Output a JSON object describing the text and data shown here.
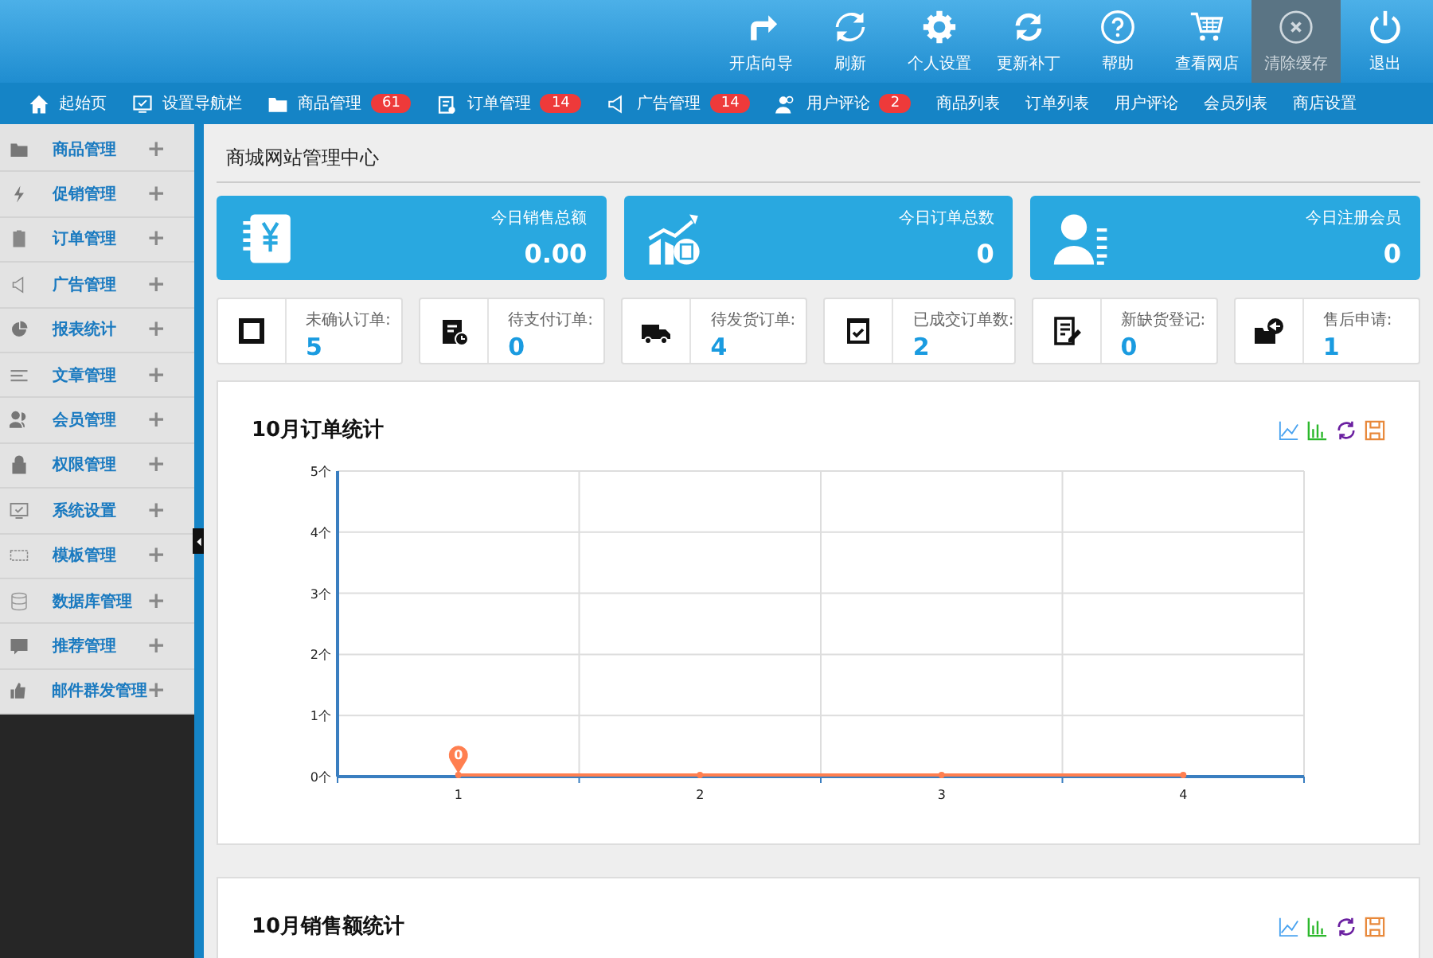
{
  "toolbar": [
    {
      "label": "开店向导",
      "selected": false
    },
    {
      "label": "刷新",
      "selected": false
    },
    {
      "label": "个人设置",
      "selected": false
    },
    {
      "label": "更新补丁",
      "selected": false
    },
    {
      "label": "帮助",
      "selected": false
    },
    {
      "label": "查看网店",
      "selected": false
    },
    {
      "label": "清除缓存",
      "selected": true
    },
    {
      "label": "退出",
      "selected": false
    }
  ],
  "nav": [
    {
      "label": "起始页"
    },
    {
      "label": "设置导航栏"
    },
    {
      "label": "商品管理",
      "badge": "61"
    },
    {
      "label": "订单管理",
      "badge": "14"
    },
    {
      "label": "广告管理",
      "badge": "14"
    },
    {
      "label": "用户评论",
      "badge": "2"
    },
    {
      "label": "商品列表"
    },
    {
      "label": "订单列表"
    },
    {
      "label": "用户评论"
    },
    {
      "label": "会员列表"
    },
    {
      "label": "商店设置"
    }
  ],
  "sidebar": {
    "items": [
      {
        "label": "商品管理",
        "toggle": "+"
      },
      {
        "label": "促销管理",
        "toggle": "+"
      },
      {
        "label": "订单管理",
        "toggle": "+"
      },
      {
        "label": "广告管理",
        "toggle": "+"
      },
      {
        "label": "报表统计",
        "toggle": "+"
      },
      {
        "label": "文章管理",
        "toggle": "+"
      },
      {
        "label": "会员管理",
        "toggle": "+"
      },
      {
        "label": "权限管理",
        "toggle": "+"
      },
      {
        "label": "系统设置",
        "toggle": "+"
      },
      {
        "label": "模板管理",
        "toggle": "+"
      },
      {
        "label": "数据库管理",
        "toggle": "+"
      },
      {
        "label": "推荐管理",
        "toggle": "+"
      },
      {
        "label": "邮件群发管理",
        "toggle": "+"
      }
    ]
  },
  "page_title": "商城网站管理中心",
  "summary": [
    {
      "label": "今日销售总额",
      "value": "0.00"
    },
    {
      "label": "今日订单总数",
      "value": "0"
    },
    {
      "label": "今日注册会员",
      "value": "0"
    }
  ],
  "counters": [
    {
      "label": "未确认订单:",
      "value": "5"
    },
    {
      "label": "待支付订单:",
      "value": "0"
    },
    {
      "label": "待发货订单:",
      "value": "4"
    },
    {
      "label": "已成交订单数:",
      "value": "2"
    },
    {
      "label": "新缺货登记:",
      "value": "0"
    },
    {
      "label": "售后申请:",
      "value": "1"
    }
  ],
  "order_chart": {
    "title": "10月订单统计",
    "chart_data": {
      "type": "line",
      "categories": [
        "1",
        "2",
        "3",
        "4"
      ],
      "series": [
        {
          "color": "#ff7f50",
          "marker": true,
          "values": [
            0,
            0,
            0,
            0
          ]
        }
      ],
      "grid": true,
      "ylim": [
        0,
        5
      ],
      "yticks": [
        {
          "value": 0,
          "label": "0个"
        },
        {
          "value": 1,
          "label": "1个"
        },
        {
          "value": 2,
          "label": "2个"
        },
        {
          "value": 3,
          "label": "3个"
        },
        {
          "value": 4,
          "label": "4个"
        },
        {
          "value": 5,
          "label": "5个"
        }
      ],
      "annotations": [
        "0"
      ]
    }
  },
  "sales_chart": {
    "title": "10月销售额统计"
  }
}
